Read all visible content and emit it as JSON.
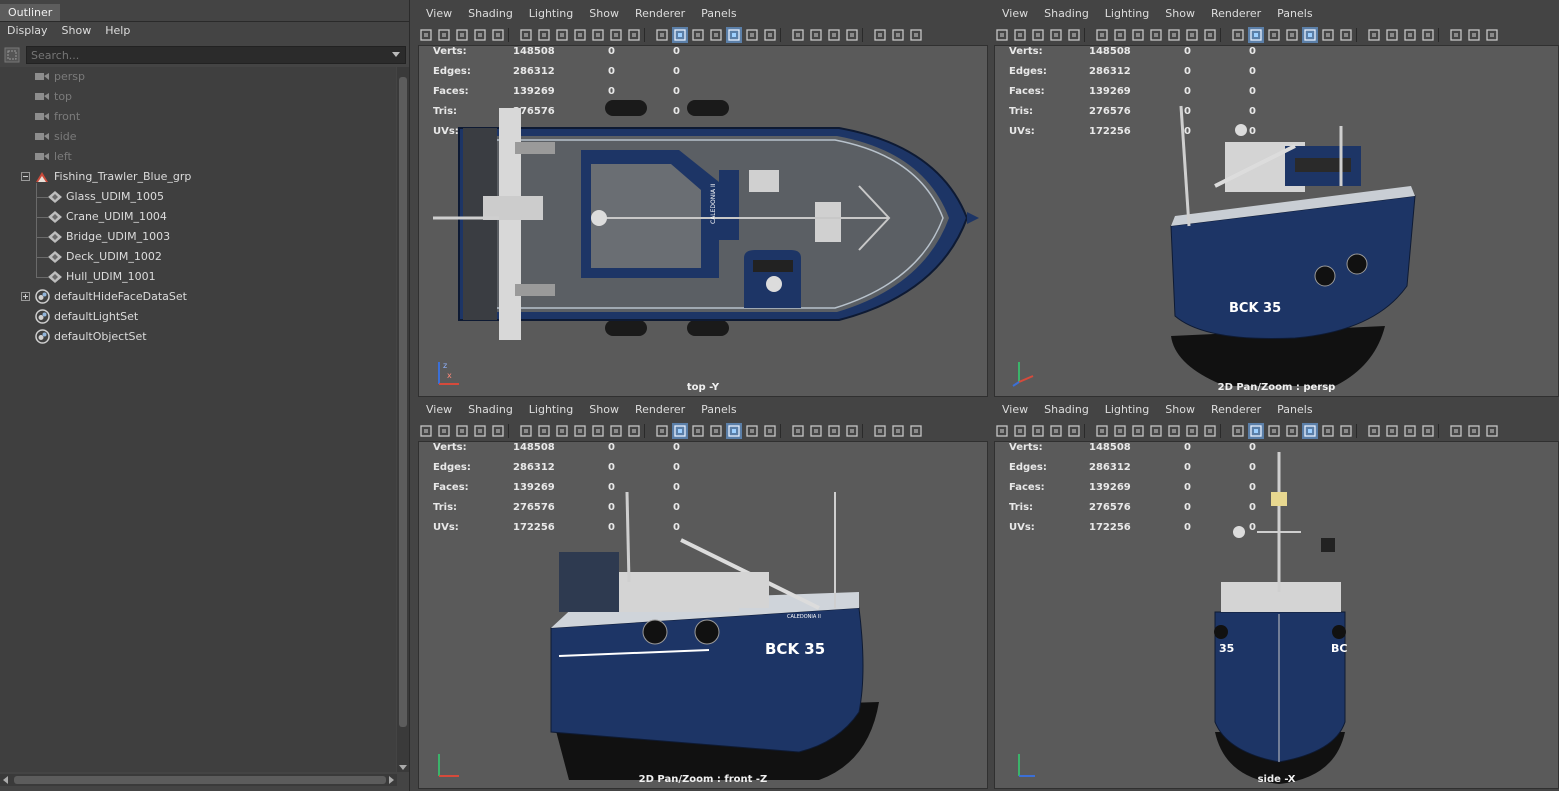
{
  "outliner": {
    "tab": "Outliner",
    "menu": [
      "Display",
      "Show",
      "Help"
    ],
    "search_placeholder": "Search...",
    "items": [
      {
        "label": "persp",
        "icon": "camera-icon"
      },
      {
        "label": "top",
        "icon": "camera-icon"
      },
      {
        "label": "front",
        "icon": "camera-icon"
      },
      {
        "label": "side",
        "icon": "camera-icon"
      },
      {
        "label": "left",
        "icon": "camera-icon"
      },
      {
        "label": "Fishing_Trawler_Blue_grp",
        "icon": "group-icon"
      },
      {
        "label": "Glass_UDIM_1005",
        "icon": "mesh-icon"
      },
      {
        "label": "Crane_UDIM_1004",
        "icon": "mesh-icon"
      },
      {
        "label": "Bridge_UDIM_1003",
        "icon": "mesh-icon"
      },
      {
        "label": "Deck_UDIM_1002",
        "icon": "mesh-icon"
      },
      {
        "label": "Hull_UDIM_1001",
        "icon": "mesh-icon"
      },
      {
        "label": "defaultHideFaceDataSet",
        "icon": "set-icon"
      },
      {
        "label": "defaultLightSet",
        "icon": "set-icon"
      },
      {
        "label": "defaultObjectSet",
        "icon": "set-icon"
      }
    ]
  },
  "viewport_menu": [
    "View",
    "Shading",
    "Lighting",
    "Show",
    "Renderer",
    "Panels"
  ],
  "hud": {
    "labels": [
      "Verts:",
      "Edges:",
      "Faces:",
      "Tris:",
      "UVs:"
    ],
    "values": [
      "148508",
      "286312",
      "139269",
      "276576",
      "172256"
    ],
    "sel": [
      "0",
      "0",
      "0",
      "0",
      "0"
    ],
    "comp": [
      "0",
      "0",
      "0",
      "0",
      "0"
    ]
  },
  "viewports": [
    {
      "camera": "top -Y"
    },
    {
      "camera": "2D Pan/Zoom : persp"
    },
    {
      "camera": "2D Pan/Zoom : front -Z"
    },
    {
      "camera": "side -X"
    }
  ],
  "ship": {
    "registration": "BCK 35",
    "name": "CALEDONIA II",
    "hull_color": "#1d3566",
    "deck_color": "#5b5f64"
  }
}
